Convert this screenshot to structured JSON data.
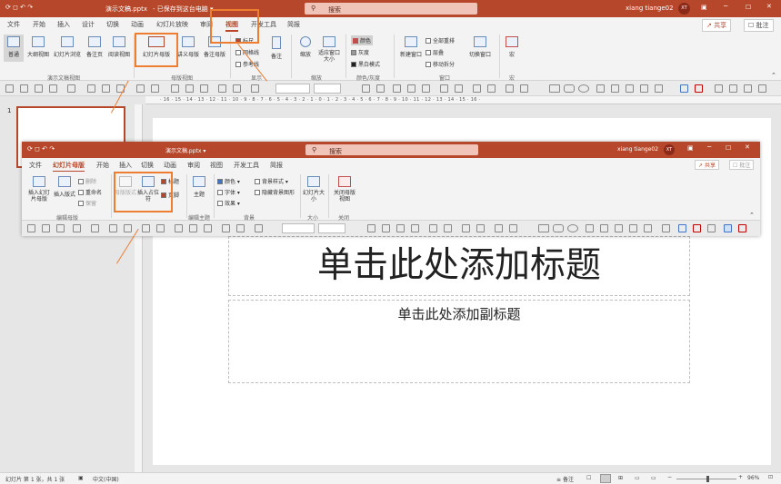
{
  "main": {
    "title_file": "演示文稿.pptx",
    "title_status": "- 已保存到这台电脑 ▾",
    "search_placeholder": "搜索",
    "user_name": "xiang tiange02",
    "avatar_initials": "XT",
    "tabs": [
      "文件",
      "开始",
      "插入",
      "设计",
      "切换",
      "动画",
      "幻灯片放映",
      "审阅",
      "视图",
      "开发工具",
      "简报"
    ],
    "active_tab": "视图",
    "share_label": "共享",
    "comment_label": "批注",
    "ribbon": {
      "presentation_views": [
        "普通",
        "大纲视图",
        "幻灯片浏览",
        "备注页",
        "阅读视图"
      ],
      "master_views": [
        "幻灯片母版",
        "讲义母版",
        "备注母版"
      ],
      "show": [
        "标尺",
        "网格线",
        "参考线"
      ],
      "notes": "备注",
      "zoom": [
        "缩放",
        "适应窗口大小"
      ],
      "color": [
        "颜色",
        "灰度",
        "黑白模式"
      ],
      "window": [
        "新建窗口",
        "全部重排",
        "层叠",
        "移动拆分",
        "切换窗口"
      ],
      "macro": "宏",
      "group_labels": [
        "演示文稿视图",
        "母版视图",
        "显示",
        "缩放",
        "颜色/灰度",
        "窗口",
        "宏"
      ]
    }
  },
  "overlay": {
    "title_file": "演示文稿.pptx ▾",
    "search_placeholder": "搜索",
    "user_name": "xiang tiange02",
    "avatar_initials": "XT",
    "tabs": [
      "文件",
      "幻灯片母版",
      "开始",
      "插入",
      "切换",
      "动画",
      "审阅",
      "视图",
      "开发工具",
      "简报"
    ],
    "active_tab": "幻灯片母版",
    "share_label": "共享",
    "comment_label": "批注",
    "ribbon": {
      "edit_master": [
        "插入幻灯片母版",
        "插入版式",
        "删除",
        "重命名",
        "保留"
      ],
      "master_layout": [
        "母版版式",
        "插入占位符",
        "标题",
        "页脚"
      ],
      "edit_theme": [
        "主题",
        "颜色",
        "字体",
        "效果"
      ],
      "background": [
        "背景样式",
        "隐藏背景图形"
      ],
      "size": "幻灯片大小",
      "close": "关闭母版视图",
      "group_labels": [
        "编辑母版",
        "母版版式",
        "编辑主题",
        "背景",
        "大小",
        "关闭"
      ]
    }
  },
  "slide": {
    "title_placeholder": "单击此处添加标题",
    "subtitle_placeholder": "单击此处添加副标题",
    "thumb_number": "1"
  },
  "status": {
    "slide_info": "幻灯片 第 1 张，共 1 张",
    "language": "中文(中国)",
    "notes": "备注",
    "zoom": "96%"
  },
  "ruler_ticks": "· 16 · 15 · 14 · 13 · 12 · 11 · 10 · 9 · 8 · 7 · 6 · 5 · 4 · 3 · 2 · 1 · 0 · 1 · 2 · 3 · 4 · 5 · 6 · 7 · 8 · 9 · 10 · 11 · 12 · 13 · 14 · 15 · 16 ·",
  "colors": {
    "accent": "#b7472a",
    "highlight": "#ed7d31",
    "ribbon": "#f3f3f3"
  }
}
